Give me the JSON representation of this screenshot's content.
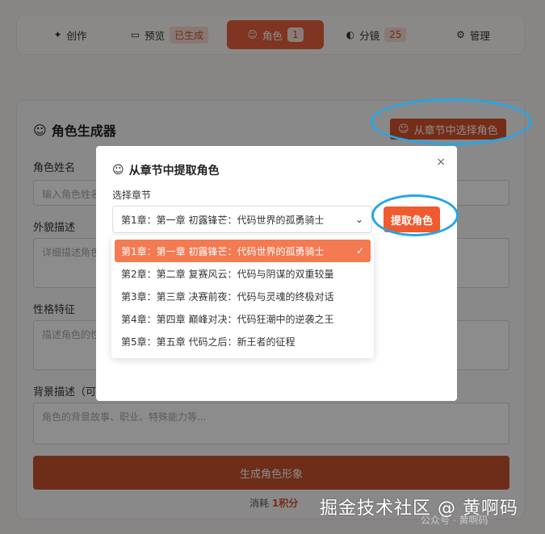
{
  "nav": {
    "tabs": [
      {
        "icon": "✦",
        "label": "创作",
        "badge": ""
      },
      {
        "icon": "▭",
        "label": "预览",
        "badge": "已生成"
      },
      {
        "icon": "☺",
        "label": "角色",
        "badge": "1"
      },
      {
        "icon": "◐",
        "label": "分镜",
        "badge": "25"
      },
      {
        "icon": "⚙",
        "label": "管理",
        "badge": ""
      }
    ]
  },
  "card": {
    "title": "角色生成器",
    "select_from_chapter": "从章节中选择角色",
    "fields": [
      {
        "label": "角色姓名",
        "placeholder": "输入角色姓名"
      },
      {
        "label": "外貌描述",
        "placeholder": "详细描述角色"
      },
      {
        "label": "性格特征",
        "placeholder": "描述角色的性"
      },
      {
        "label": "背景描述（可选",
        "placeholder": "角色的背景故事、职业、特殊能力等..."
      }
    ],
    "generate_button": "生成角色形象",
    "cost_prefix": "消耗",
    "cost_value": "1积分"
  },
  "modal": {
    "title": "从章节中提取角色",
    "close": "×",
    "chapter_label": "选择章节",
    "selected": "第1章：第一章 初露锋芒：代码世界的孤勇骑士",
    "extract_button": "提取角色",
    "options": [
      "第1章：第一章 初露锋芒：代码世界的孤勇骑士",
      "第2章：第二章 复赛风云：代码与阴谋的双重较量",
      "第3章：第三章 决赛前夜：代码与灵魂的终极对话",
      "第4章：第四章 巅峰对决：代码狂潮中的逆袭之王",
      "第5章：第五章 代码之后：新王者的征程"
    ]
  },
  "watermark": "掘金技术社区 @ 黄啊码",
  "watermark2": "公众号 · 黄啊码",
  "colors": {
    "accent": "#e8613c",
    "highlight": "#24a6e8"
  }
}
